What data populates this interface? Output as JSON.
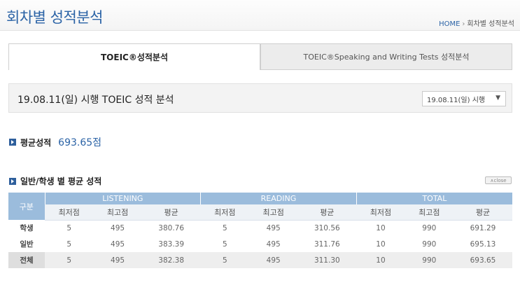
{
  "header": {
    "title": "회차별 성적분석",
    "breadcrumb_home": "HOME",
    "breadcrumb_sep": "›",
    "breadcrumb_current": "회차별 성적분석"
  },
  "tabs": [
    {
      "label": "TOEIC®성적분석",
      "active": true
    },
    {
      "label": "TOEIC®Speaking and Writing Tests 성적분석",
      "active": false
    }
  ],
  "exam": {
    "title": "19.08.11(일) 시행 TOEIC 성적 분석",
    "select_value": "19.08.11(일) 시행"
  },
  "average": {
    "label": "평균성적",
    "value": "693.65점"
  },
  "table_section": {
    "label": "일반/학생 별 평균 성적",
    "close_label": "∧close",
    "row_header": "구분",
    "groups": [
      "LISTENING",
      "READING",
      "TOTAL"
    ],
    "subheaders": [
      "최저점",
      "최고점",
      "평균",
      "최저점",
      "최고점",
      "평균",
      "최저점",
      "최고점",
      "평균"
    ],
    "rows": [
      {
        "label": "학생",
        "cells": [
          "5",
          "495",
          "380.76",
          "5",
          "495",
          "310.56",
          "10",
          "990",
          "691.29"
        ]
      },
      {
        "label": "일반",
        "cells": [
          "5",
          "495",
          "383.39",
          "5",
          "495",
          "311.76",
          "10",
          "990",
          "695.13"
        ]
      },
      {
        "label": "전체",
        "cells": [
          "5",
          "495",
          "382.38",
          "5",
          "495",
          "311.30",
          "10",
          "990",
          "693.65"
        ]
      }
    ]
  },
  "colors": {
    "accent": "#2b63a6",
    "table_header": "#9bbcdc"
  }
}
